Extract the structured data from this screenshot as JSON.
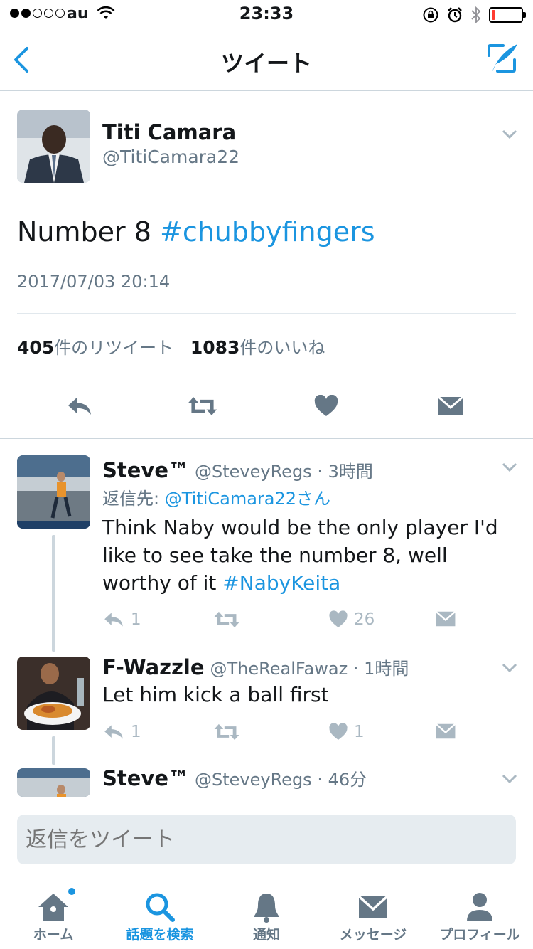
{
  "status": {
    "carrier": "au",
    "time": "23:33",
    "battery_level": 0.12,
    "battery_color": "#ff3b30"
  },
  "nav": {
    "title": "ツイート",
    "back_icon": "chevron-left-icon",
    "compose_icon": "compose-icon"
  },
  "tweet": {
    "name": "Titi Camara",
    "handle": "@TitiCamara22",
    "text": "Number 8 ",
    "hashtag": "#chubbyfingers",
    "timestamp": "2017/07/03 20:14",
    "retweet_count": "405",
    "retweet_label": "件のリツイート",
    "like_count": "1083",
    "like_label": "件のいいね"
  },
  "replies": [
    {
      "name": "Steve™",
      "handle": "@SteveyRegs",
      "time": "· 3時間",
      "reply_to_prefix": "返信先: ",
      "reply_to": "@TitiCamara22さん",
      "text_line1": "Think Naby would be the only player I'd",
      "text_line2": "like to see take the number 8, well",
      "text_line3": "worthy of it ",
      "hashtag": "#NabyKeita",
      "reply_count": "1",
      "like_count": "26"
    },
    {
      "name": "F-Wazzle",
      "handle": "@TheRealFawaz",
      "time": "· 1時間",
      "text": "Let him kick a ball first",
      "reply_count": "1",
      "like_count": "1"
    },
    {
      "name": "Steve™",
      "handle": "@SteveyRegs",
      "time": "· 46分"
    }
  ],
  "reply_box": {
    "placeholder": "返信をツイート"
  },
  "tabs": [
    {
      "label": "ホーム",
      "icon": "home-icon"
    },
    {
      "label": "話題を検索",
      "icon": "search-icon"
    },
    {
      "label": "通知",
      "icon": "bell-icon"
    },
    {
      "label": "メッセージ",
      "icon": "envelope-icon"
    },
    {
      "label": "プロフィール",
      "icon": "person-icon"
    }
  ],
  "colors": {
    "accent": "#1b95e0",
    "secondary_text": "#657786",
    "icon_gray": "#aab8c2",
    "main_action_gray": "#657786"
  }
}
